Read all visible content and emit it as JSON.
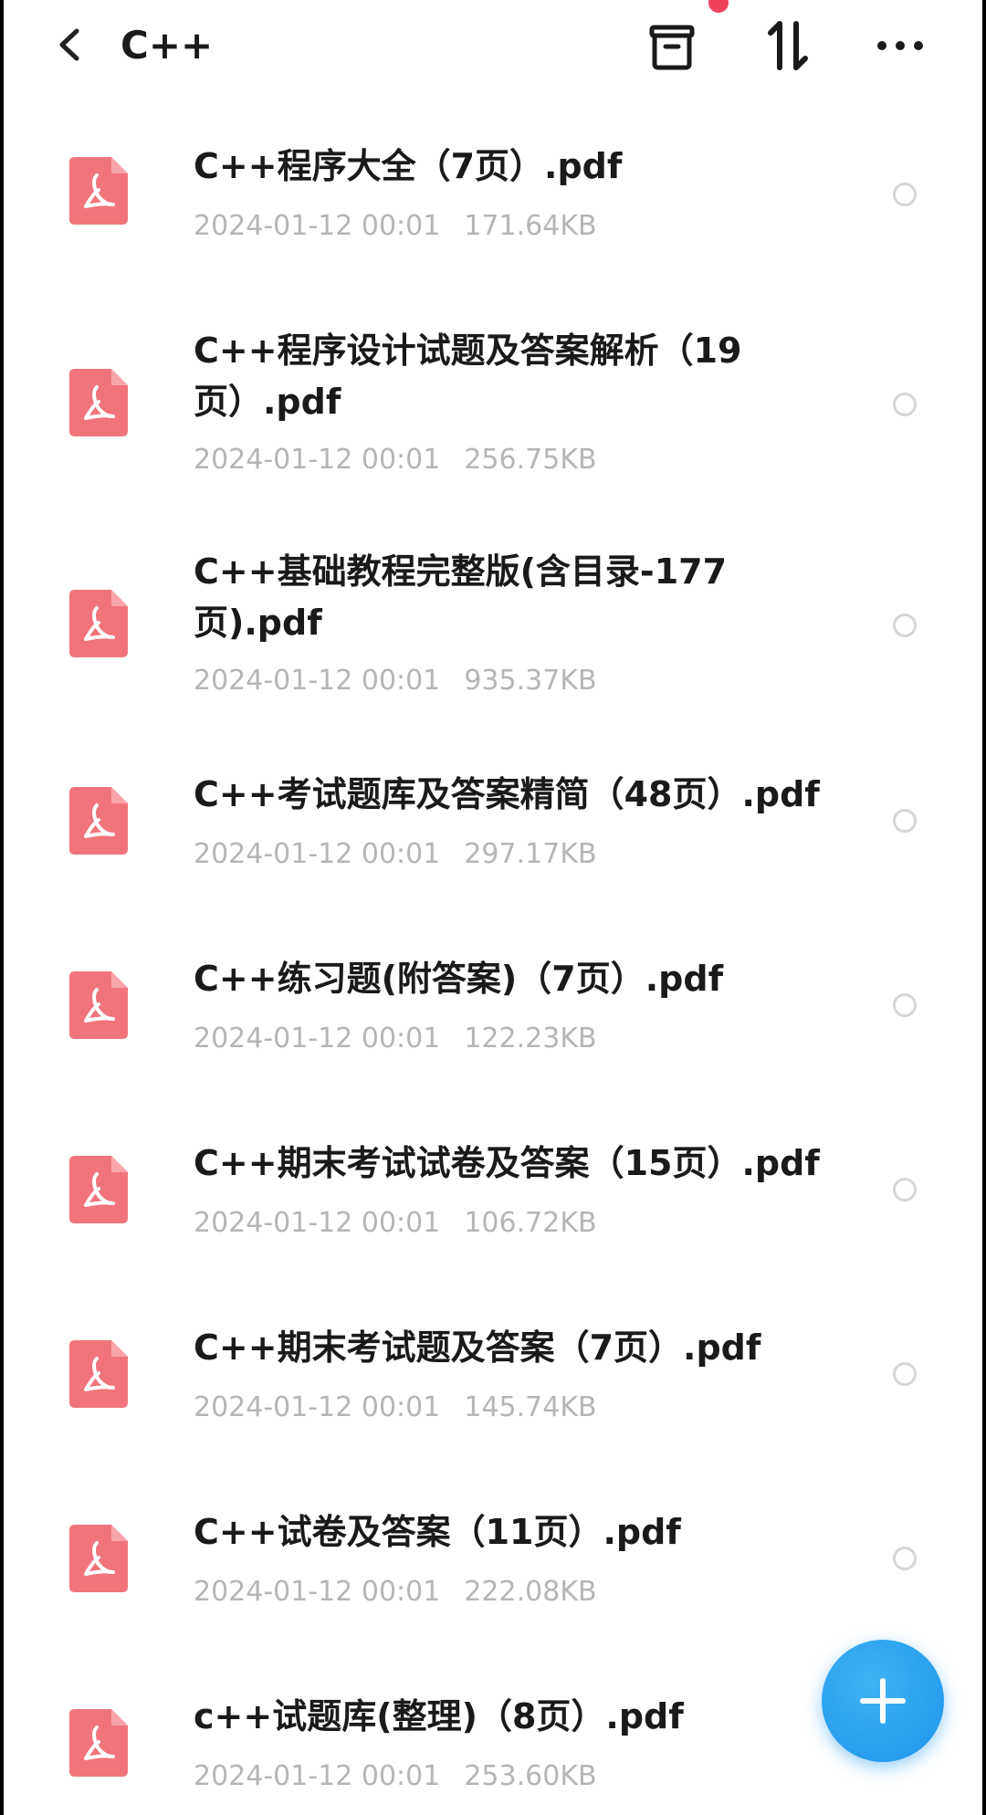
{
  "header": {
    "title": "C++",
    "icons": [
      "chevron-left-icon",
      "archive-box-icon",
      "sort-arrows-icon",
      "more-horizontal-icon"
    ],
    "notify_dot_color": "#f0425a"
  },
  "files": [
    {
      "name": "C++程序大全（7页）.pdf",
      "date": "2024-01-12  00:01",
      "size": "171.64KB"
    },
    {
      "name": "C++程序设计试题及答案解析（19\n页）.pdf",
      "date": "2024-01-12  00:01",
      "size": "256.75KB"
    },
    {
      "name": "C++基础教程完整版(含目录-177\n页).pdf",
      "date": "2024-01-12  00:01",
      "size": "935.37KB"
    },
    {
      "name": "C++考试题库及答案精简（48页）.pdf",
      "date": "2024-01-12  00:01",
      "size": "297.17KB"
    },
    {
      "name": "C++练习题(附答案)（7页）.pdf",
      "date": "2024-01-12  00:01",
      "size": "122.23KB"
    },
    {
      "name": "C++期末考试试卷及答案（15页）.pdf",
      "date": "2024-01-12  00:01",
      "size": "106.72KB"
    },
    {
      "name": "C++期末考试题及答案（7页）.pdf",
      "date": "2024-01-12  00:01",
      "size": "145.74KB"
    },
    {
      "name": "C++试卷及答案（11页）.pdf",
      "date": "2024-01-12  00:01",
      "size": "222.08KB"
    },
    {
      "name": "c++试题库(整理)（8页）.pdf",
      "date": "2024-01-12  00:01",
      "size": "253.60KB"
    }
  ],
  "colors": {
    "pdf_icon": "#f0747a",
    "fab": "#2aa3ef",
    "meta_text": "#b5b5b5",
    "title_text": "#1a1a1a"
  },
  "fab": {
    "icon": "plus-icon"
  }
}
